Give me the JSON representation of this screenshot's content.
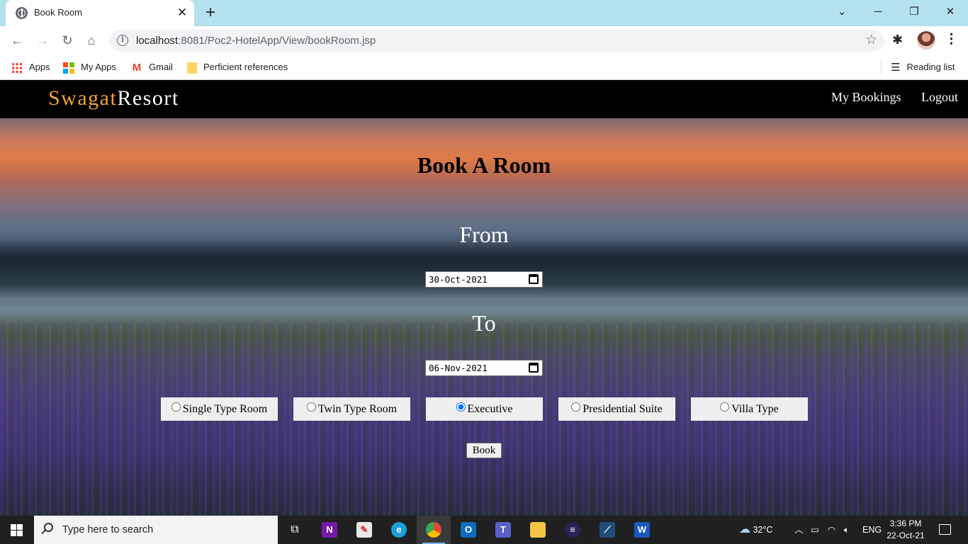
{
  "browser": {
    "tab": {
      "title": "Book Room"
    },
    "omnibox": {
      "host": "localhost",
      "path": ":8081/Poc2-HotelApp/View/bookRoom.jsp"
    },
    "bookmarks": [
      {
        "label": "Apps",
        "icon": "apps-grid-icon"
      },
      {
        "label": "My Apps",
        "icon": "microsoft-logo-icon"
      },
      {
        "label": "Gmail",
        "icon": "gmail-icon"
      },
      {
        "label": "Perficient references",
        "icon": "folder-icon"
      }
    ],
    "reading_list": "Reading list"
  },
  "site": {
    "brand_part1": "Swagat",
    "brand_part2": "Resort",
    "nav": {
      "my_bookings": "My Bookings",
      "logout": "Logout"
    }
  },
  "form": {
    "title": "Book A Room",
    "from_label": "From",
    "from_date": "30-Oct-2021",
    "to_label": "To",
    "to_date": "06-Nov-2021",
    "room_types": [
      {
        "label": "Single Type Room",
        "checked": false
      },
      {
        "label": "Twin Type Room",
        "checked": false
      },
      {
        "label": "Executive",
        "checked": true
      },
      {
        "label": "Presidential Suite",
        "checked": false
      },
      {
        "label": "Villa Type",
        "checked": false
      }
    ],
    "submit_label": "Book"
  },
  "taskbar": {
    "search_placeholder": "Type here to search",
    "weather": "32°C",
    "language": "ENG",
    "time": "3:36 PM",
    "date": "22-Oct-21"
  }
}
